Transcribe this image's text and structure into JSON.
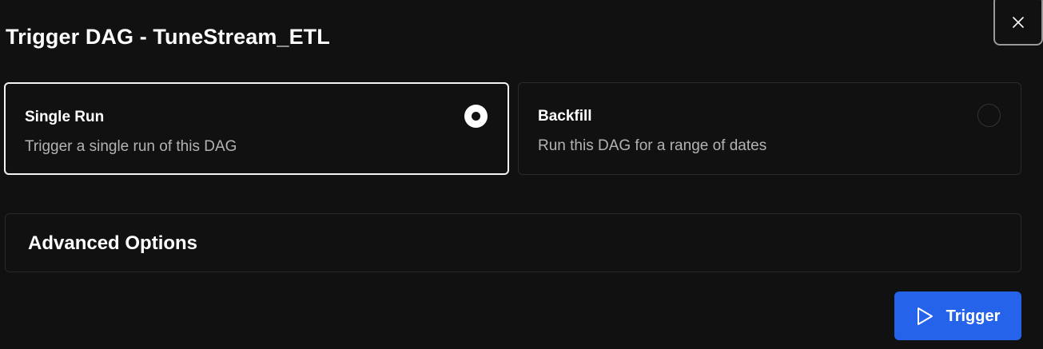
{
  "dialog": {
    "title": "Trigger DAG - TuneStream_ETL",
    "close_icon": "close-icon"
  },
  "run_options": [
    {
      "title": "Single Run",
      "description": "Trigger a single run of this DAG",
      "selected": true
    },
    {
      "title": "Backfill",
      "description": "Run this DAG for a range of dates",
      "selected": false
    }
  ],
  "advanced_options": {
    "label": "Advanced Options"
  },
  "actions": {
    "trigger_label": "Trigger",
    "trigger_icon": "play-icon"
  },
  "colors": {
    "background": "#111111",
    "primary_button": "#2563eb",
    "selected_border": "#f4f4f4",
    "muted_text": "#b3b3b3"
  }
}
